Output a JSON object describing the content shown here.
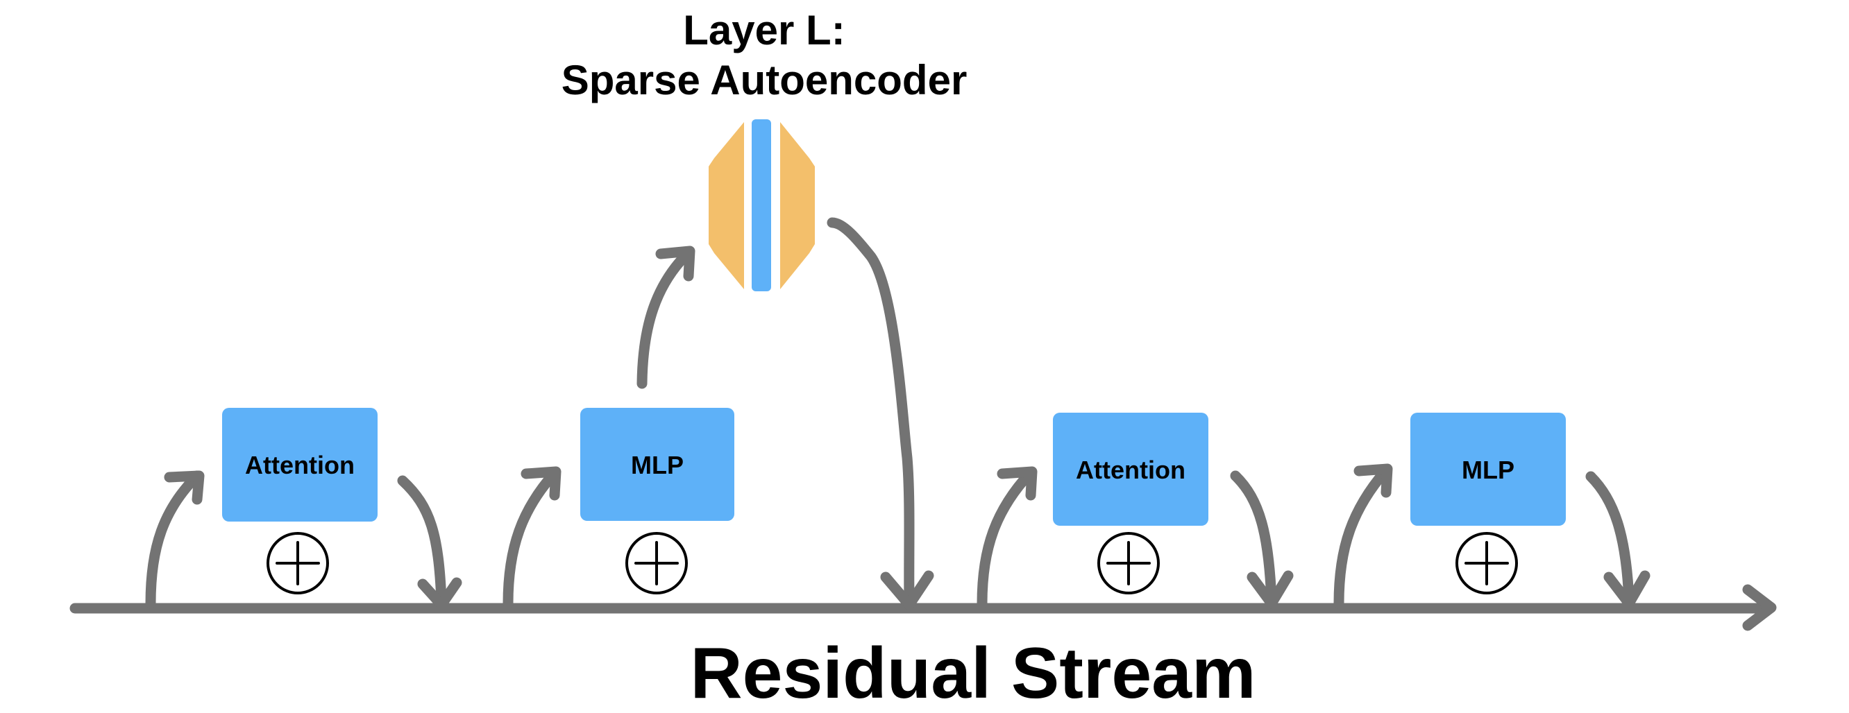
{
  "title": {
    "line1": "Layer L:",
    "line2": "Sparse Autoencoder"
  },
  "residual_stream_label": "Residual Stream",
  "colors": {
    "block_fill": "#5eb1f8",
    "encoder_fill": "#f3bf6b",
    "latent_fill": "#5eb1f8",
    "arrow": "#737373",
    "text": "#000000"
  },
  "blocks": [
    {
      "id": "attention-1",
      "label": "Attention",
      "icon": "circled-plus-icon"
    },
    {
      "id": "mlp-1",
      "label": "MLP",
      "icon": "circled-plus-icon"
    },
    {
      "id": "attention-2",
      "label": "Attention",
      "icon": "circled-plus-icon"
    },
    {
      "id": "mlp-2",
      "label": "MLP",
      "icon": "circled-plus-icon"
    }
  ],
  "sae": {
    "label": "Sparse Autoencoder",
    "parts": [
      "encoder",
      "latent",
      "decoder"
    ]
  }
}
